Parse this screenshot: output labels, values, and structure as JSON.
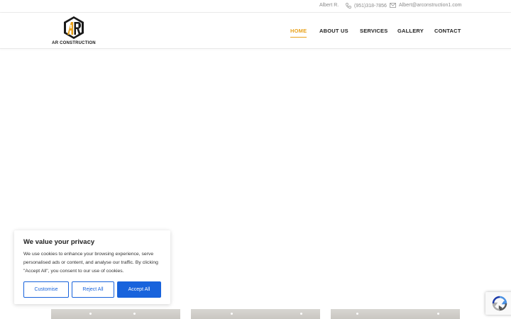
{
  "topbar": {
    "name": "Albert R.",
    "phone": "(951)318-7856",
    "email": "Albert@arconstruction1.com"
  },
  "brand": {
    "logo_text": "AR CONSTRUCTION",
    "accent": "#e9a21c"
  },
  "nav": {
    "home": "HOME",
    "about": "ABOUT US",
    "services": "SERVICES",
    "gallery": "GALLERY",
    "contact": "CONTACT"
  },
  "cookie": {
    "title": "We value your privacy",
    "body": "We use cookies to enhance your browsing experience, serve personalised ads or content, and analyse our traffic. By clicking \"Accept All\", you consent to our use of cookies.",
    "customise": "Customise",
    "reject": "Reject All",
    "accept": "Accept All",
    "button_color": "#1863dc"
  },
  "icons": {
    "phone": "phone-icon",
    "email": "envelope-icon",
    "recaptcha": "recaptcha-icon"
  }
}
